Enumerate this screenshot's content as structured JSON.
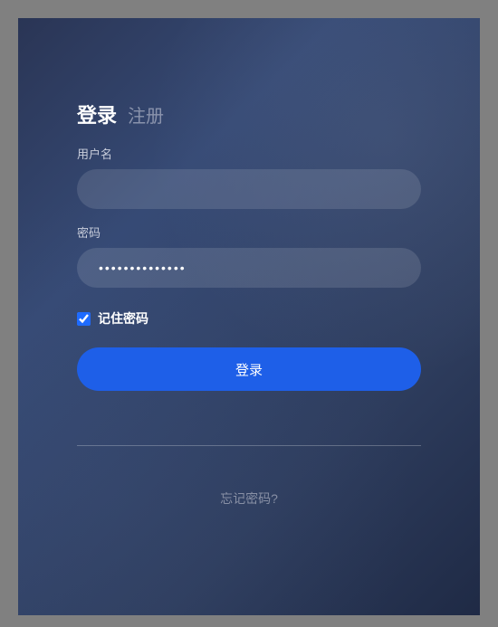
{
  "tabs": {
    "login": "登录",
    "register": "注册"
  },
  "usernameLabel": "用户名",
  "usernameValue": "",
  "passwordLabel": "密码",
  "passwordValue": "••••••••••••••",
  "rememberLabel": "记住密码",
  "rememberChecked": true,
  "loginButton": "登录",
  "forgotPassword": "忘记密码?",
  "colors": {
    "accent": "#1e5fe8"
  }
}
